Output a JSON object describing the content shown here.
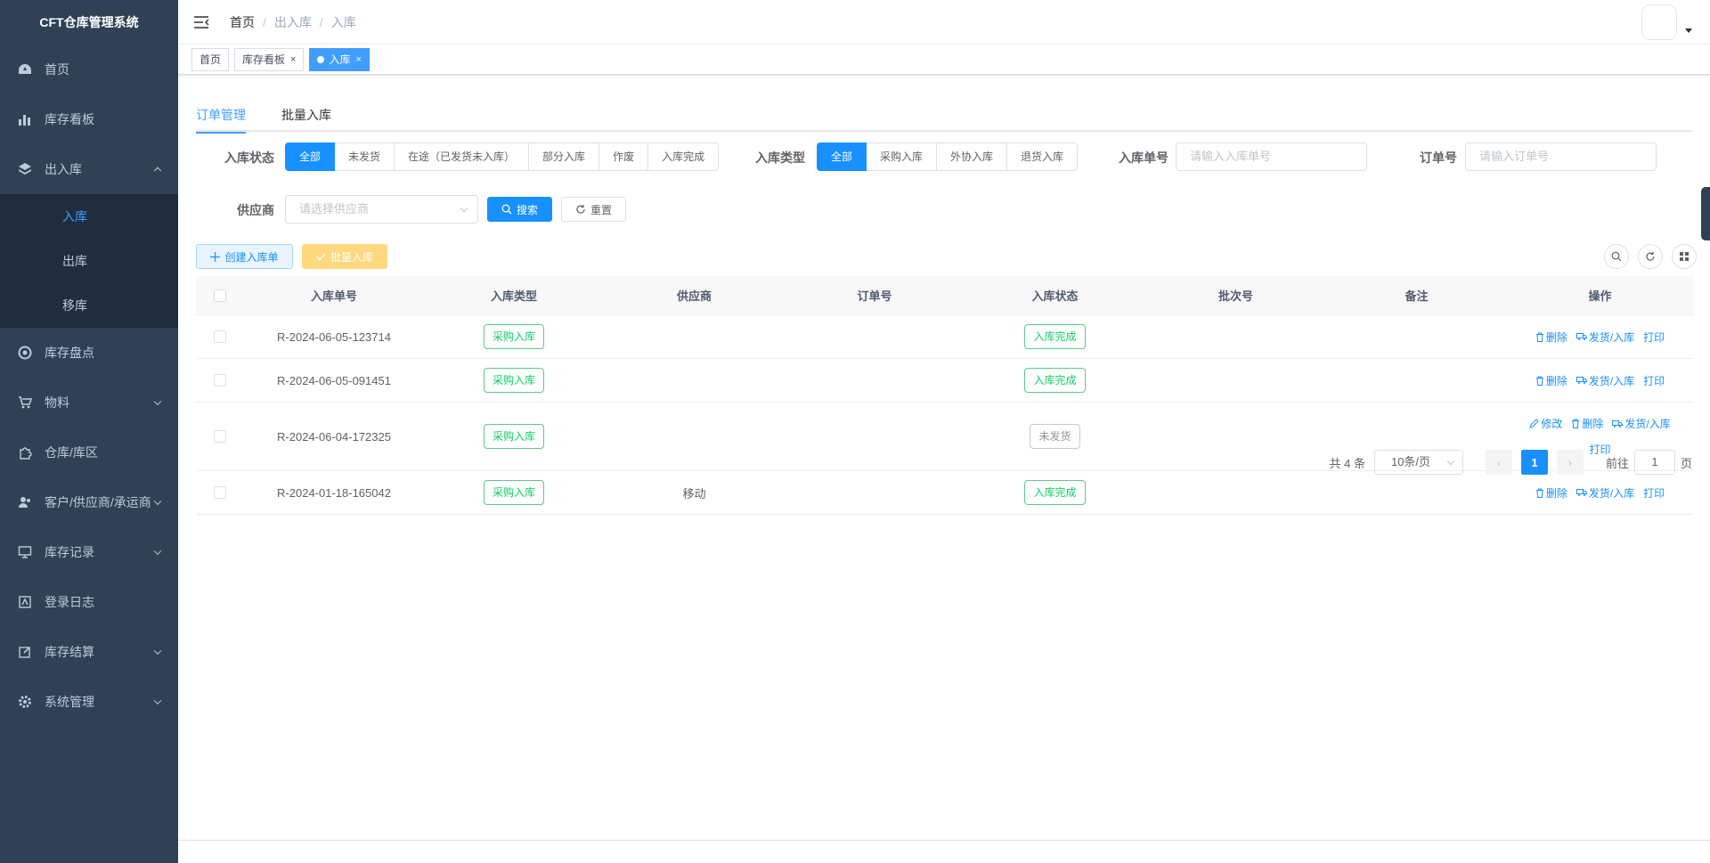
{
  "app": {
    "title": "CFT仓库管理系统"
  },
  "sidebar": {
    "items": [
      {
        "label": "首页",
        "icon": "dashboard-icon"
      },
      {
        "label": "库存看板",
        "icon": "chart-icon"
      },
      {
        "label": "出入库",
        "icon": "layers-icon",
        "expanded": true,
        "children": [
          {
            "label": "入库",
            "active": true
          },
          {
            "label": "出库"
          },
          {
            "label": "移库"
          }
        ]
      },
      {
        "label": "库存盘点",
        "icon": "target-icon"
      },
      {
        "label": "物料",
        "icon": "cart-icon"
      },
      {
        "label": "仓库/库区",
        "icon": "puzzle-icon"
      },
      {
        "label": "客户/供应商/承运商",
        "icon": "people-icon"
      },
      {
        "label": "库存记录",
        "icon": "monitor-icon"
      },
      {
        "label": "登录日志",
        "icon": "log-icon"
      },
      {
        "label": "库存结算",
        "icon": "edit-icon"
      },
      {
        "label": "系统管理",
        "icon": "gear-icon"
      }
    ]
  },
  "navbar": {
    "breadcrumb": [
      "首页",
      "出入库",
      "入库"
    ]
  },
  "tags": [
    {
      "label": "首页"
    },
    {
      "label": "库存看板",
      "closable": true
    },
    {
      "label": "入库",
      "closable": true,
      "active": true
    }
  ],
  "tabs": [
    {
      "label": "订单管理",
      "active": true
    },
    {
      "label": "批量入库"
    }
  ],
  "filters": {
    "status_label": "入库状态",
    "status_options": [
      "全部",
      "未发货",
      "在途（已发货未入库）",
      "部分入库",
      "作废",
      "入库完成"
    ],
    "type_label": "入库类型",
    "type_options": [
      "全部",
      "采购入库",
      "外协入库",
      "退货入库"
    ],
    "receipt_no_label": "入库单号",
    "receipt_no_placeholder": "请输入入库单号",
    "order_no_label": "订单号",
    "order_no_placeholder": "请输入订单号",
    "supplier_label": "供应商",
    "supplier_placeholder": "请选择供应商",
    "search_label": "搜索",
    "reset_label": "重置"
  },
  "toolbar": {
    "create_label": "创建入库单",
    "batch_label": "批量入库"
  },
  "table": {
    "columns": [
      "入库单号",
      "入库类型",
      "供应商",
      "订单号",
      "入库状态",
      "批次号",
      "备注",
      "操作"
    ],
    "rows": [
      {
        "no": "R-2024-06-05-123714",
        "type": "采购入库",
        "supplier": "",
        "order": "",
        "status": "入库完成",
        "status_kind": "success",
        "batch": "",
        "remark": "",
        "ops": [
          "删除",
          "发货/入库",
          "打印"
        ]
      },
      {
        "no": "R-2024-06-05-091451",
        "type": "采购入库",
        "supplier": "",
        "order": "",
        "status": "入库完成",
        "status_kind": "success",
        "batch": "",
        "remark": "",
        "ops": [
          "删除",
          "发货/入库",
          "打印"
        ]
      },
      {
        "no": "R-2024-06-04-172325",
        "type": "采购入库",
        "supplier": "",
        "order": "",
        "status": "未发货",
        "status_kind": "info",
        "batch": "",
        "remark": "",
        "ops": [
          "修改",
          "删除",
          "发货/入库",
          "打印"
        ]
      },
      {
        "no": "R-2024-01-18-165042",
        "type": "采购入库",
        "supplier": "移动",
        "order": "",
        "status": "入库完成",
        "status_kind": "success",
        "batch": "",
        "remark": "",
        "ops": [
          "删除",
          "发货/入库",
          "打印"
        ]
      }
    ]
  },
  "pagination": {
    "total_text": "共 4 条",
    "page_size": "10条/页",
    "current_page": "1",
    "goto_prefix": "前往",
    "goto_value": "1",
    "goto_suffix": "页"
  },
  "colors": {
    "primary": "#1890ff",
    "sidebar_bg": "#304156",
    "submenu_bg": "#1f2d3d",
    "success": "#13ce66"
  }
}
